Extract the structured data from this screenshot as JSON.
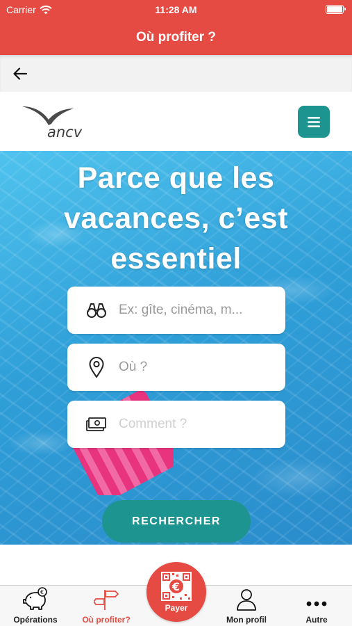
{
  "status_bar": {
    "carrier": "Carrier",
    "time": "11:28 AM"
  },
  "nav": {
    "title": "Où profiter ?"
  },
  "brand": {
    "logo_text": "ancv"
  },
  "hero": {
    "line1": "Parce que les",
    "line2": "vacances, c’est",
    "line3": "essentiel"
  },
  "search": {
    "what_placeholder": "Ex: gîte, cinéma, m...",
    "where_placeholder": "Où ?",
    "how_placeholder": "Comment ?",
    "button_label": "RECHERCHER"
  },
  "tabs": [
    {
      "label": "Opérations",
      "icon": "piggy-bank-euro-icon"
    },
    {
      "label": "Où profiter?",
      "icon": "signpost-icon"
    },
    {
      "label": "Payer",
      "icon": "qr-euro-icon"
    },
    {
      "label": "Mon profil",
      "icon": "person-icon"
    },
    {
      "label": "Autre",
      "icon": "more-dots-icon"
    }
  ],
  "colors": {
    "brand_red": "#e54a43",
    "teal": "#1e9490",
    "water_blue": "#3aaee3"
  }
}
